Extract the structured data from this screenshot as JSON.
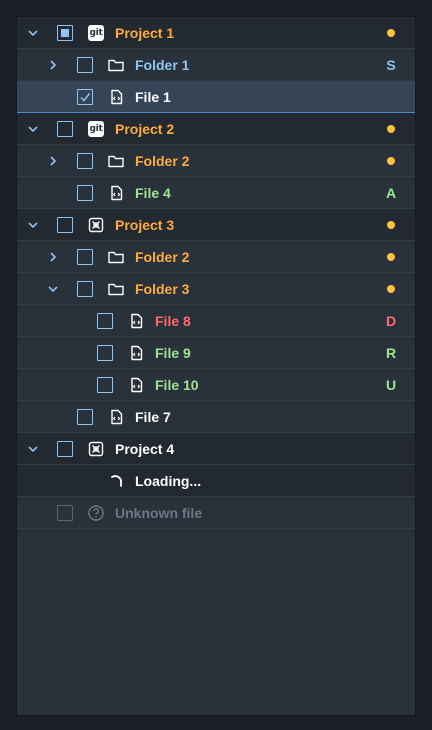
{
  "colors": {
    "accent": "#8fc3f2",
    "modified": "#ffab40",
    "added": "#a2e38f",
    "deleted": "#ff6b6b",
    "dot": "#ffc042",
    "panel_bg": "#29313a",
    "selected_bg": "#364556"
  },
  "tree": {
    "rows": [
      {
        "label": "Project 1",
        "badge": "",
        "status": "modified",
        "icon": "git-icon",
        "checkbox": "partial",
        "expanded": true
      },
      {
        "label": "Folder 1",
        "badge": "S",
        "status": "staged",
        "icon": "folder-icon",
        "checkbox": "unchecked",
        "expanded": false
      },
      {
        "label": "File 1",
        "badge": "",
        "status": "none",
        "icon": "code-file-icon",
        "checkbox": "checked",
        "selected": true
      },
      {
        "label": "Project 2",
        "badge": "",
        "status": "modified",
        "icon": "git-icon",
        "checkbox": "unchecked",
        "expanded": true
      },
      {
        "label": "Folder 2",
        "badge": "",
        "status": "modified",
        "icon": "folder-icon",
        "checkbox": "unchecked",
        "expanded": false
      },
      {
        "label": "File 4",
        "badge": "A",
        "status": "added",
        "icon": "code-file-icon",
        "checkbox": "unchecked"
      },
      {
        "label": "Project 3",
        "badge": "",
        "status": "modified",
        "icon": "box-x-icon",
        "checkbox": "unchecked",
        "expanded": true
      },
      {
        "label": "Folder 2",
        "badge": "",
        "status": "modified",
        "icon": "folder-icon",
        "checkbox": "unchecked",
        "expanded": false
      },
      {
        "label": "Folder 3",
        "badge": "",
        "status": "modified",
        "icon": "folder-icon",
        "checkbox": "unchecked",
        "expanded": true
      },
      {
        "label": "File 8",
        "badge": "D",
        "status": "deleted",
        "icon": "code-file-icon",
        "checkbox": "unchecked"
      },
      {
        "label": "File 9",
        "badge": "R",
        "status": "renamed",
        "icon": "code-file-icon",
        "checkbox": "unchecked"
      },
      {
        "label": "File 10",
        "badge": "U",
        "status": "untracked",
        "icon": "code-file-icon",
        "checkbox": "unchecked"
      },
      {
        "label": "File 7",
        "badge": "",
        "status": "none",
        "icon": "code-file-icon",
        "checkbox": "unchecked"
      },
      {
        "label": "Project 4",
        "badge": "",
        "status": "none",
        "icon": "box-x-icon",
        "checkbox": "unchecked",
        "expanded": true
      },
      {
        "label": "Loading...",
        "badge": "",
        "status": "loading",
        "icon": "spinner-icon"
      },
      {
        "label": "Unknown file",
        "badge": "",
        "status": "unknown",
        "icon": "question-circle-icon",
        "checkbox": "disabled"
      }
    ]
  }
}
